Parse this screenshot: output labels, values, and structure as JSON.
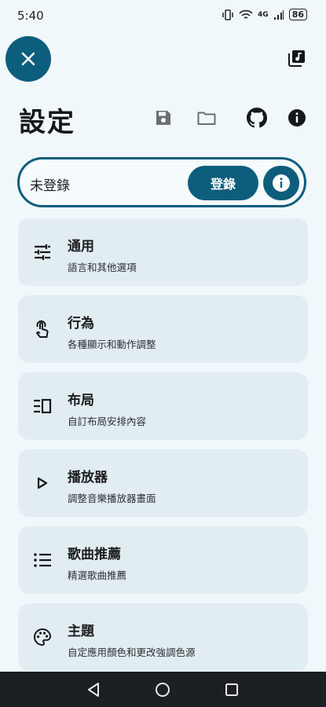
{
  "status_bar": {
    "time": "5:40",
    "network": "4G",
    "battery": "86"
  },
  "header": {
    "title": "設定"
  },
  "account": {
    "status": "未登錄",
    "login_label": "登錄"
  },
  "settings": [
    {
      "title": "通用",
      "subtitle": "語言和其他選項",
      "icon": "tune-icon"
    },
    {
      "title": "行為",
      "subtitle": "各種顯示和動作調整",
      "icon": "touch-app-icon"
    },
    {
      "title": "布局",
      "subtitle": "自訂布局安排內容",
      "icon": "view-list-icon"
    },
    {
      "title": "播放器",
      "subtitle": "調整音樂播放器畫面",
      "icon": "play-icon"
    },
    {
      "title": "歌曲推薦",
      "subtitle": "精選歌曲推薦",
      "icon": "list-icon"
    },
    {
      "title": "主題",
      "subtitle": "自定應用顏色和更改強調色源",
      "icon": "palette-icon"
    }
  ],
  "colors": {
    "accent": "#0d5d7d",
    "background": "#f1f8fc",
    "card": "#e2edf1",
    "nav_bar": "#1c1f23"
  }
}
